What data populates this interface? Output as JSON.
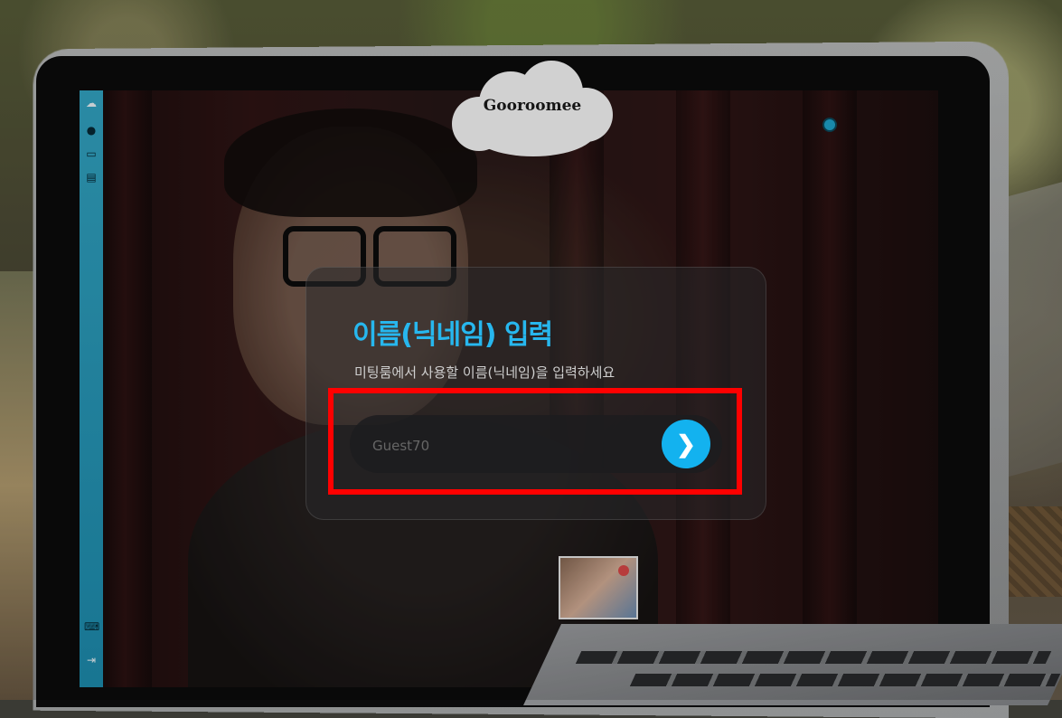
{
  "app": {
    "logo_text": "Gooroomee"
  },
  "sidebar": {
    "items": [
      {
        "icon": "chat-cloud-icon"
      },
      {
        "icon": "user-icon"
      },
      {
        "icon": "monitor-icon"
      },
      {
        "icon": "document-icon"
      },
      {
        "icon": "keyboard-icon"
      },
      {
        "icon": "exit-icon"
      }
    ]
  },
  "dialog": {
    "title": "이름(닉네임) 입력",
    "subtitle": "미팅룸에서 사용할 이름(닉네임)을 입력하세요",
    "nickname": {
      "placeholder": "Guest70",
      "value": ""
    },
    "submit_icon": "chevron-right-icon"
  },
  "colors": {
    "accent": "#13b2ef",
    "title": "#27b7ee",
    "sidebar": "#2a9fc2",
    "highlight": "#ff0000"
  }
}
